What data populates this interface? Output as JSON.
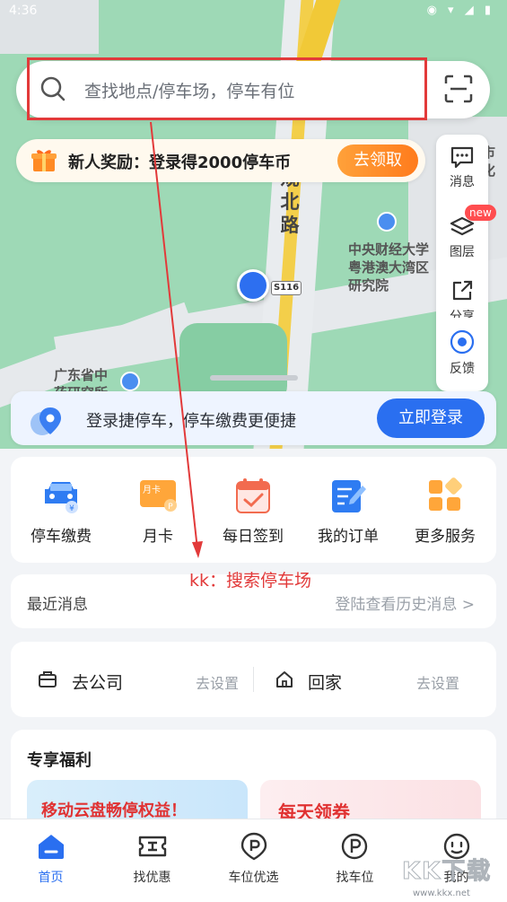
{
  "status_bar": {
    "time": "4:36",
    "icons": "◉ ▾ ◢ ▮"
  },
  "map": {
    "road_name": "观北路",
    "university_label": "中央财经大学粤港澳大湾区研究院",
    "institute_label": "广东省中药研究所",
    "shield": "S116",
    "corner_label": "州市 文化"
  },
  "search": {
    "placeholder": "查找地点/停车场，停车有位"
  },
  "promo": {
    "text": "新人奖励：登录得2000停车币",
    "button": "去领取"
  },
  "tools": {
    "messages": "消息",
    "layers": "图层",
    "layers_badge": "new",
    "share": "分享",
    "feedback": "反馈"
  },
  "login_banner": {
    "text": "登录捷停车，停车缴费更便捷",
    "button": "立即登录"
  },
  "services": [
    {
      "label": "停车缴费"
    },
    {
      "label": "月卡",
      "icon_text": "月卡"
    },
    {
      "label": "每日签到"
    },
    {
      "label": "我的订单"
    },
    {
      "label": "更多服务"
    }
  ],
  "annotation": "kk：搜索停车场",
  "recent_news": {
    "title": "最近消息",
    "link": "登陆查看历史消息 >"
  },
  "addresses": {
    "company": "去公司",
    "company_set": "去设置",
    "home": "回家",
    "home_set": "去设置"
  },
  "benefits": {
    "title": "专享福利",
    "card1": "移动云盘畅停权益！",
    "card2": "每天领券"
  },
  "nav": [
    {
      "label": "首页"
    },
    {
      "label": "找优惠"
    },
    {
      "label": "车位优选"
    },
    {
      "label": "找车位"
    },
    {
      "label": "我的"
    }
  ],
  "watermark": "KK下载",
  "watermark_url": "www.kkx.net",
  "colors": {
    "accent": "#2a6ff0",
    "promo_orange": "#ff8a24",
    "annotation_red": "#e23a3a"
  }
}
